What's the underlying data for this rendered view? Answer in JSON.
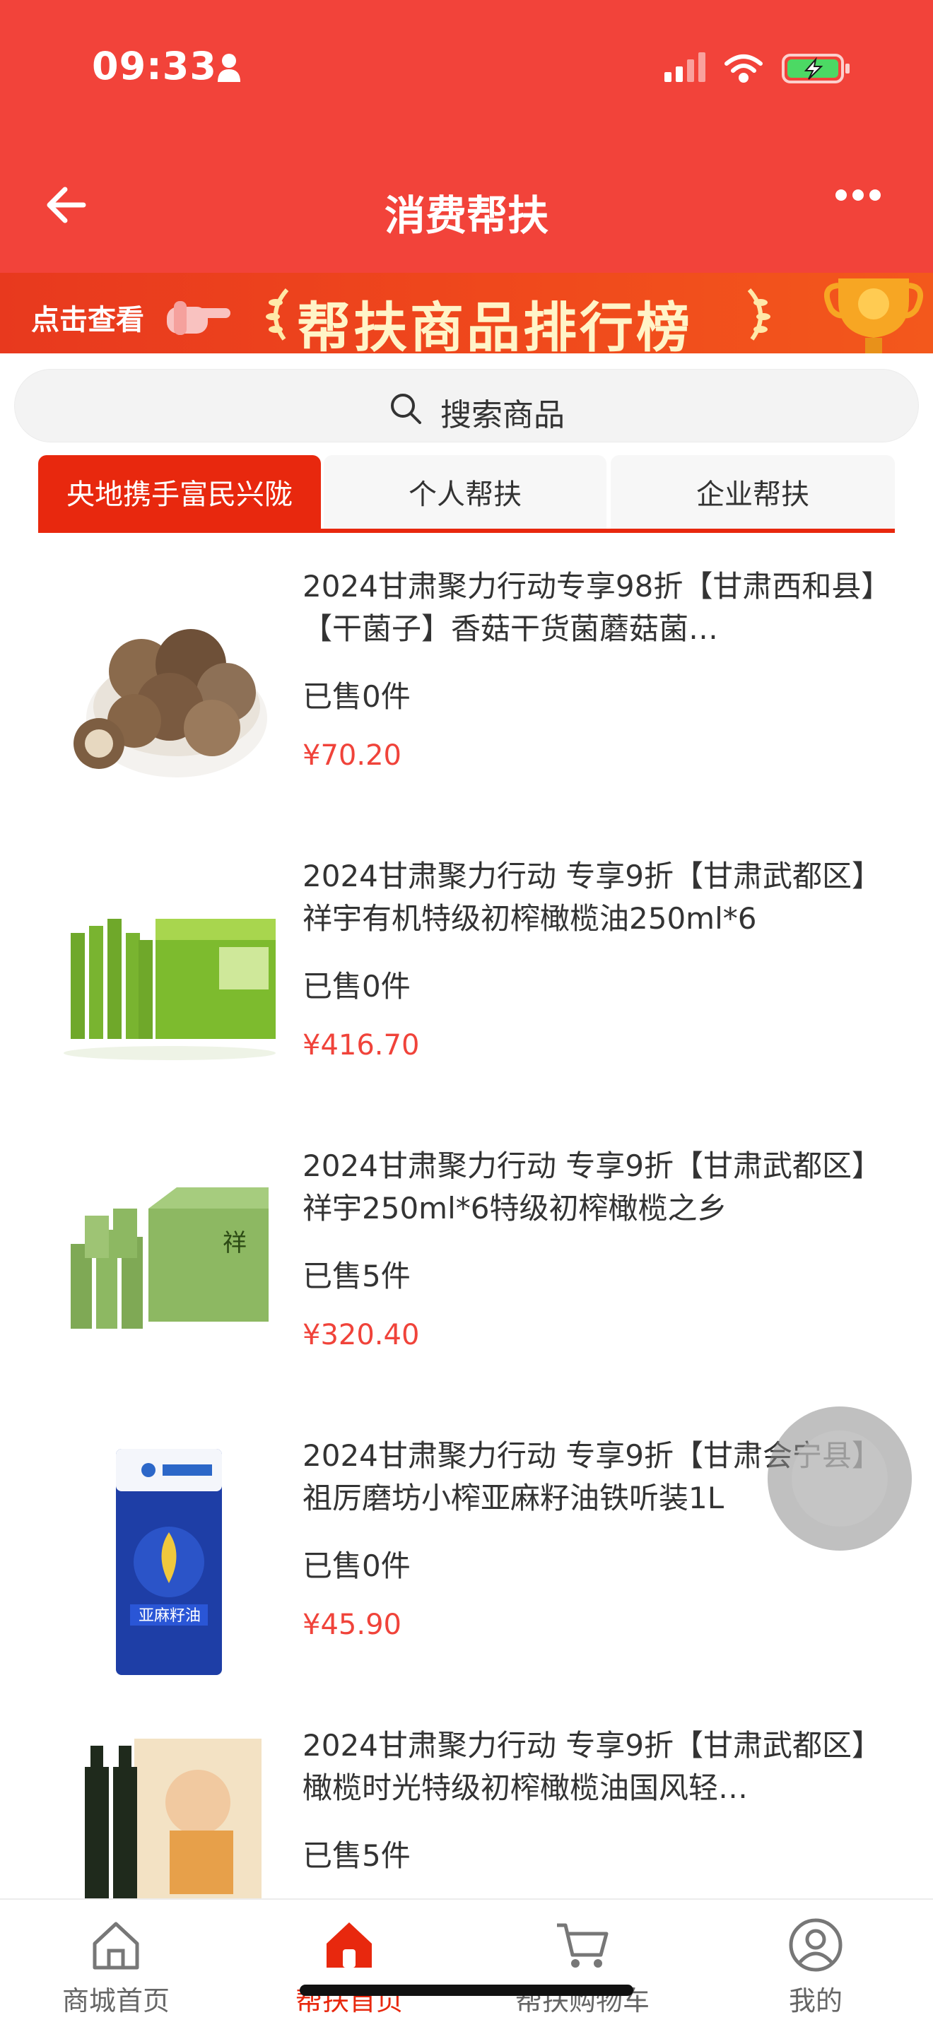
{
  "status": {
    "time": "09:33"
  },
  "nav": {
    "title": "消费帮扶"
  },
  "banner": {
    "left_text": "点击查看",
    "title": "帮扶商品排行榜"
  },
  "search": {
    "placeholder": "搜索商品"
  },
  "tabs": [
    {
      "label": "央地携手富民兴陇",
      "active": true
    },
    {
      "label": "个人帮扶",
      "active": false
    },
    {
      "label": "企业帮扶",
      "active": false
    }
  ],
  "products": [
    {
      "title": "2024甘肃聚力行动专享98折【甘肃西和县】【干菌子】香菇干货菌蘑菇菌…",
      "sold": "已售0件",
      "price": "¥70.20",
      "image": "mushroom"
    },
    {
      "title": "2024甘肃聚力行动 专享9折【甘肃武都区】祥宇有机特级初榨橄榄油250ml*6",
      "sold": "已售0件",
      "price": "¥416.70",
      "image": "olive-oil-box"
    },
    {
      "title": "2024甘肃聚力行动 专享9折【甘肃武都区】祥宇250ml*6特级初榨橄榄之乡",
      "sold": "已售5件",
      "price": "¥320.40",
      "image": "olive-oil-green-box"
    },
    {
      "title": "2024甘肃聚力行动 专享9折【甘肃会宁县】祖厉磨坊小榨亚麻籽油铁听装1L",
      "sold": "已售0件",
      "price": "¥45.90",
      "image": "flaxseed-oil-can"
    },
    {
      "title": "2024甘肃聚力行动 专享9折【甘肃武都区】橄榄时光特级初榨橄榄油国风轻…",
      "sold": "已售5件",
      "price": "",
      "image": "olive-oil-gift"
    }
  ],
  "tabbar": [
    {
      "label": "商城首页",
      "icon": "home-outline-icon",
      "active": false
    },
    {
      "label": "帮扶首页",
      "icon": "home-filled-icon",
      "active": true
    },
    {
      "label": "帮扶购物车",
      "icon": "cart-icon",
      "active": false
    },
    {
      "label": "我的",
      "icon": "user-icon",
      "active": false
    }
  ],
  "colors": {
    "primary": "#f2433a",
    "accent": "#e8280e",
    "price": "#f0433a"
  }
}
